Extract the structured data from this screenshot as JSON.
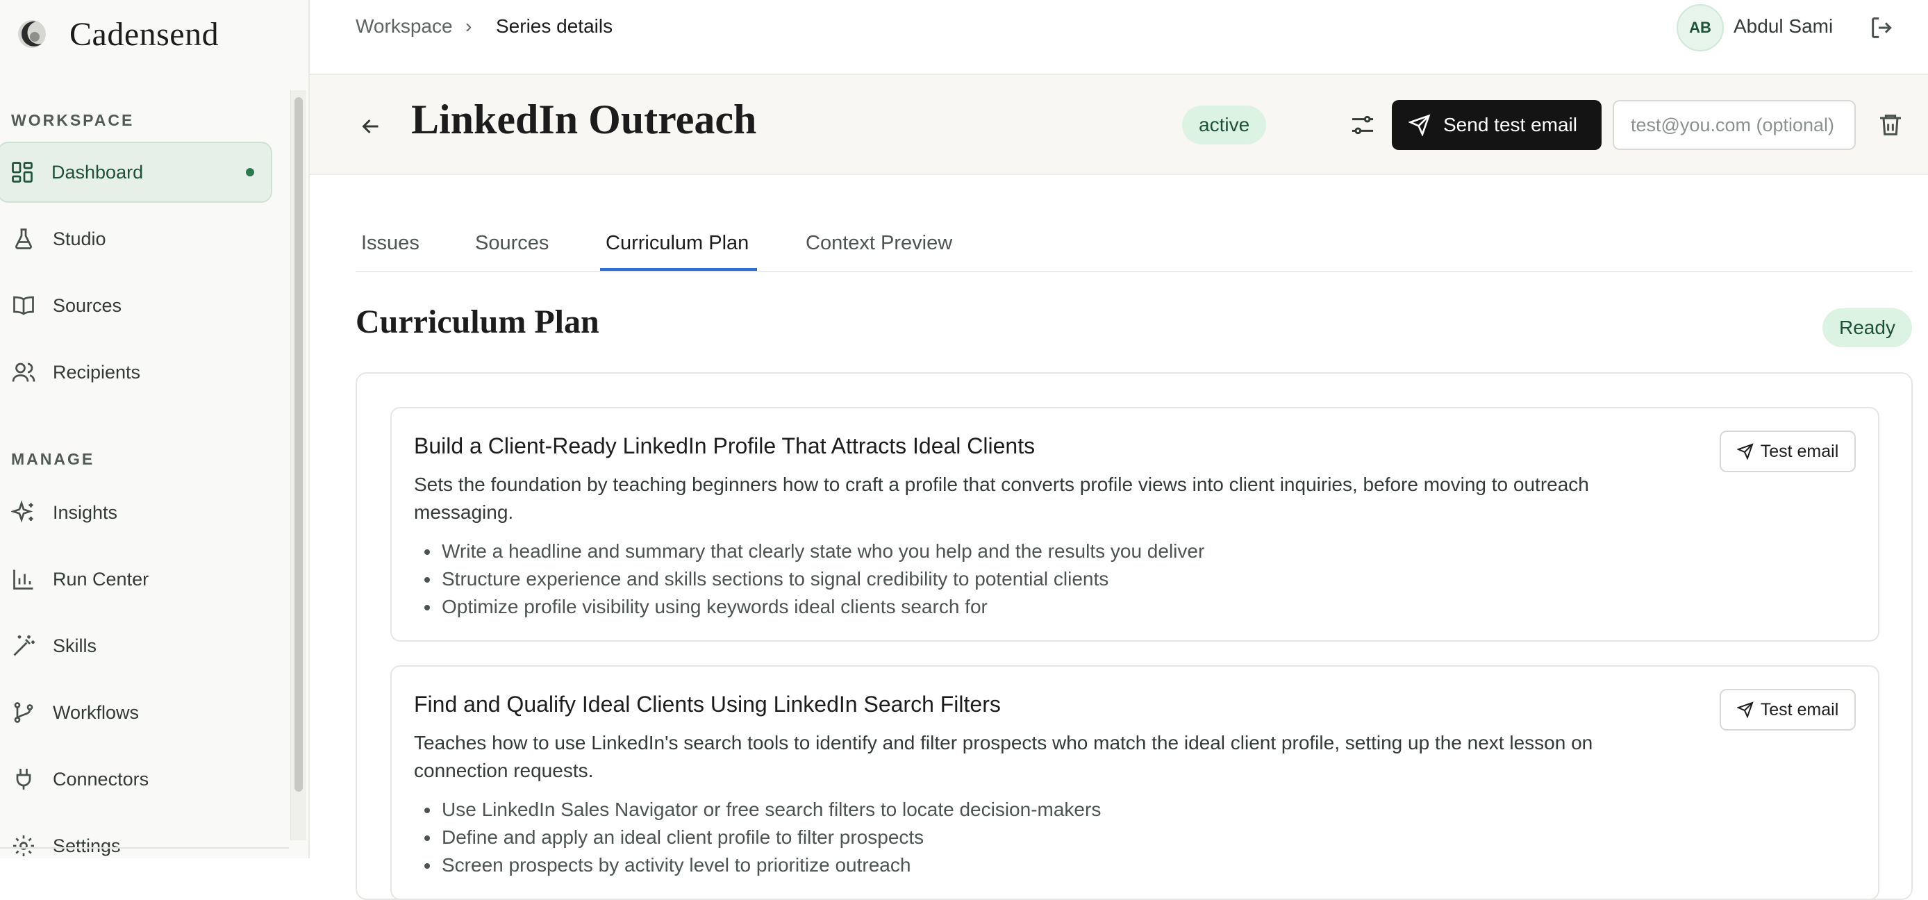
{
  "app": {
    "brand": "Cadensend"
  },
  "sidebar": {
    "workspace_label": "WORKSPACE",
    "manage_label": "MANAGE",
    "workspace_items": [
      {
        "label": "Dashboard",
        "icon": "dashboard-icon",
        "active": true
      },
      {
        "label": "Studio",
        "icon": "flask-icon"
      },
      {
        "label": "Sources",
        "icon": "book-icon"
      },
      {
        "label": "Recipients",
        "icon": "users-icon"
      }
    ],
    "manage_items": [
      {
        "label": "Insights",
        "icon": "sparkles-icon"
      },
      {
        "label": "Run Center",
        "icon": "bar-chart-icon"
      },
      {
        "label": "Skills",
        "icon": "wand-icon"
      },
      {
        "label": "Workflows",
        "icon": "branch-icon"
      },
      {
        "label": "Connectors",
        "icon": "plug-icon"
      },
      {
        "label": "Settings",
        "icon": "gear-icon"
      }
    ]
  },
  "topbar": {
    "breadcrumb": [
      "Workspace",
      "Series details"
    ],
    "separator": "›",
    "user_initials": "AB",
    "user_name": "Abdul Sami"
  },
  "series": {
    "title": "LinkedIn Outreach",
    "status": "active",
    "send_label": "Send test email",
    "email_placeholder": "test@you.com (optional)"
  },
  "tabs": [
    {
      "label": "Issues"
    },
    {
      "label": "Sources"
    },
    {
      "label": "Curriculum Plan",
      "active": true
    },
    {
      "label": "Context Preview"
    }
  ],
  "plan": {
    "title": "Curriculum Plan",
    "status": "Ready",
    "lessons": [
      {
        "title": "Build a Client-Ready LinkedIn Profile That Attracts Ideal Clients",
        "description": "Sets the foundation by teaching beginners how to craft a profile that converts profile views into client inquiries, before moving to outreach messaging.",
        "points": [
          "Write a headline and summary that clearly state who you help and the results you deliver",
          "Structure experience and skills sections to signal credibility to potential clients",
          "Optimize profile visibility using keywords ideal clients search for"
        ],
        "button_label": "Test email"
      },
      {
        "title": "Find and Qualify Ideal Clients Using LinkedIn Search Filters",
        "description": "Teaches how to use LinkedIn's search tools to identify and filter prospects who match the ideal client profile, setting up the next lesson on connection requests.",
        "points": [
          "Use LinkedIn Sales Navigator or free search filters to locate decision-makers",
          "Define and apply an ideal client profile to filter prospects",
          "Screen prospects by activity level to prioritize outreach"
        ],
        "button_label": "Test email"
      }
    ]
  },
  "colors": {
    "accent_green": "#2f7a4d",
    "tab_underline": "#2d6fd8",
    "primary_button": "#141414"
  }
}
